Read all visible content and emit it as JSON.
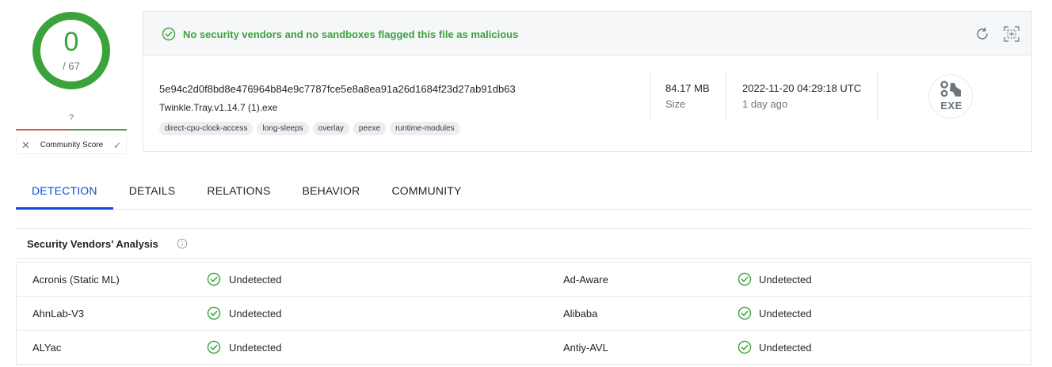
{
  "score": {
    "detections": "0",
    "total": "/ 67",
    "community_value": "?",
    "community_label": "Community Score",
    "community_fraction": 0.5
  },
  "summary": {
    "message": "No security vendors and no sandboxes flagged this file as malicious",
    "hash": "5e94c2d0f8bd8e476964b84e9c7787fce5e8a8ea91a26d1684f23d27ab91db63",
    "filename": "Twinkle.Tray.v1.14.7 (1).exe",
    "tags": [
      "direct-cpu-clock-access",
      "long-sleeps",
      "overlay",
      "peexe",
      "runtime-modules"
    ],
    "size_value": "84.17 MB",
    "size_label": "Size",
    "date_value": "2022-11-20 04:29:18 UTC",
    "date_label": "1 day ago",
    "file_type": "EXE"
  },
  "tabs": [
    {
      "label": "DETECTION",
      "active": true
    },
    {
      "label": "DETAILS",
      "active": false
    },
    {
      "label": "RELATIONS",
      "active": false
    },
    {
      "label": "BEHAVIOR",
      "active": false
    },
    {
      "label": "COMMUNITY",
      "active": false
    }
  ],
  "analysis": {
    "title": "Security Vendors' Analysis",
    "rows": [
      [
        {
          "vendor": "Acronis (Static ML)",
          "result": "Undetected"
        },
        {
          "vendor": "Ad-Aware",
          "result": "Undetected"
        }
      ],
      [
        {
          "vendor": "AhnLab-V3",
          "result": "Undetected"
        },
        {
          "vendor": "Alibaba",
          "result": "Undetected"
        }
      ],
      [
        {
          "vendor": "ALYac",
          "result": "Undetected"
        },
        {
          "vendor": "Antiy-AVL",
          "result": "Undetected"
        }
      ]
    ]
  },
  "colors": {
    "clean_green": "#3ba33b",
    "accent_blue": "#0b4dda",
    "community_red": "#d9534f",
    "muted_gray": "#6c757d"
  },
  "icons": {
    "head_status": "check-circle-icon",
    "reload": "reload-icon",
    "expand": "expand-icon",
    "info": "info-icon",
    "result_status": "check-circle-icon",
    "file_type": "exe-gears-icon"
  }
}
